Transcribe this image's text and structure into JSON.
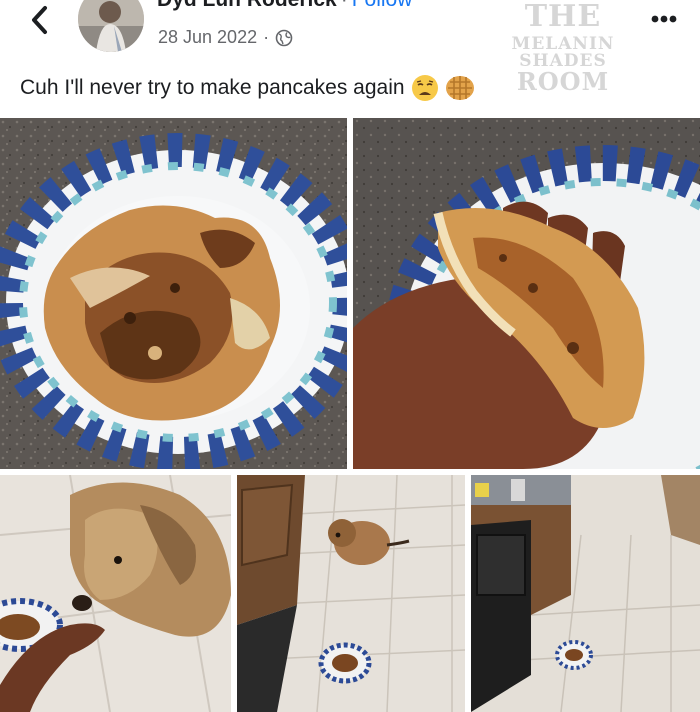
{
  "post": {
    "author_name": "Dyd Luh Roderick",
    "separator": "·",
    "follow_label": "Follow",
    "date": "28 Jun 2022",
    "date_separator": "·",
    "caption": "Cuh I'll never try to make pancakes again",
    "caption_emojis": [
      "weary-face-emoji",
      "waffle-emoji"
    ]
  },
  "watermark": {
    "line1": "THE",
    "line2": "MELANIN",
    "line3": "SHADES",
    "line4": "ROOM"
  },
  "icons": {
    "back": "chevron-left-icon",
    "privacy": "globe-icon",
    "more": "more-options-icon"
  },
  "colors": {
    "text": "#1c1e21",
    "secondary": "#65676b",
    "link": "#1877f2"
  },
  "photos": [
    "burnt-pancakes-on-plate",
    "hand-holding-pancake",
    "dog-sniffing-pancake",
    "dog-on-kitchen-floor-with-plate",
    "kitchen-floor-with-plate"
  ]
}
